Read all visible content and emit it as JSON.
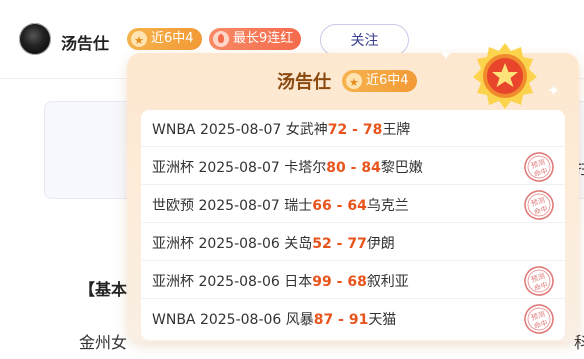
{
  "author": {
    "name": "汤告仕",
    "rate_badge": "近6中4",
    "streak_badge": "最长9连红",
    "follow_label": "关注"
  },
  "background": {
    "cut_text": "拄",
    "section_heading": "【基本",
    "paragraph_start": "金州女",
    "paragraph_end": "科"
  },
  "popup": {
    "name": "汤告仕",
    "rate_badge": "近6中4",
    "stamp_text": "预测命中",
    "rows": [
      {
        "league": "WNBA",
        "date": "2025-08-07",
        "home": "女武神",
        "home_score": "72",
        "sep": " - ",
        "away_score": "78",
        "away": "王牌",
        "hit": false
      },
      {
        "league": "亚洲杯",
        "date": "2025-08-07",
        "home": "卡塔尔",
        "home_score": "80",
        "sep": " - ",
        "away_score": "84",
        "away": "黎巴嫩",
        "hit": true
      },
      {
        "league": "世欧预",
        "date": "2025-08-07",
        "home": "瑞士",
        "home_score": "66",
        "sep": " - ",
        "away_score": "64",
        "away": "乌克兰",
        "hit": true
      },
      {
        "league": "亚洲杯",
        "date": "2025-08-06",
        "home": "关岛",
        "home_score": "52",
        "sep": " - ",
        "away_score": "77",
        "away": "伊朗",
        "hit": false
      },
      {
        "league": "亚洲杯",
        "date": "2025-08-06",
        "home": "日本",
        "home_score": "99",
        "sep": " - ",
        "away_score": "68",
        "away": "叙利亚",
        "hit": true
      },
      {
        "league": "WNBA",
        "date": "2025-08-06",
        "home": "风暴",
        "home_score": "87",
        "sep": " - ",
        "away_score": "91",
        "away": "天猫",
        "hit": true
      }
    ]
  },
  "colors": {
    "score": "#e8541c",
    "rate_badge": "#f29a36",
    "streak_badge": "#f56b4c",
    "follow_text": "#3a3d8c",
    "stamp": "#e07b7b"
  },
  "icons": {
    "rate_badge_icon": "star-icon",
    "streak_badge_icon": "flame-icon",
    "medal": "star-medal-icon",
    "stamp": "prediction-hit-stamp-icon"
  }
}
